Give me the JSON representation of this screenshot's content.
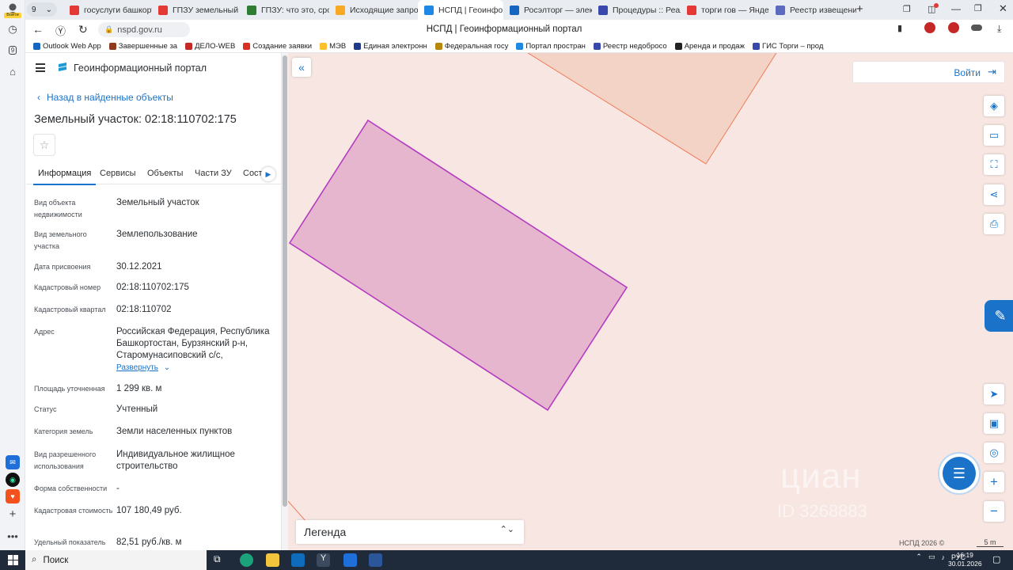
{
  "browser": {
    "tab_count": "9",
    "avatar_label": "Войти",
    "tabs": [
      {
        "label": "госуслуги башкорто",
        "color": "#e53935"
      },
      {
        "label": "ГПЗУ земельный ко",
        "color": "#e53935"
      },
      {
        "label": "ГПЗУ: что это, срок з",
        "color": "#2e7d32"
      },
      {
        "label": "Исходящие запросы",
        "color": "#f9a825"
      },
      {
        "label": "НСПД | Геоинфор",
        "color": "#1e88e5",
        "active": true
      },
      {
        "label": "Росэлторг — электр",
        "color": "#1565c0"
      },
      {
        "label": "Процедуры :: Реали",
        "color": "#3949ab"
      },
      {
        "label": "торги гов — Яндекс",
        "color": "#e53935"
      },
      {
        "label": "Реестр извещений",
        "color": "#5c6bc0"
      }
    ],
    "url": "nspd.gov.ru",
    "page_title": "НСПД | Геоинформационный портал",
    "bookmarks": [
      {
        "label": "Outlook Web App",
        "color": "#1565c0"
      },
      {
        "label": "Завершенные за",
        "color": "#8d3b1d"
      },
      {
        "label": "ДЕЛО-WEB",
        "color": "#c62828"
      },
      {
        "label": "Создание заявки",
        "color": "#d93025"
      },
      {
        "label": "МЭВ",
        "color": "#fbc02d"
      },
      {
        "label": "Единая электронн",
        "color": "#1e3a8a"
      },
      {
        "label": "Федеральная госу",
        "color": "#b8860b"
      },
      {
        "label": "Портал простран",
        "color": "#1e88e5"
      },
      {
        "label": "Реестр недобросо",
        "color": "#3949ab"
      },
      {
        "label": "Аренда и продаж",
        "color": "#222222"
      },
      {
        "label": "ГИС Торги – прод",
        "color": "#3949ab"
      }
    ]
  },
  "panel": {
    "brand": "Геоинформационный портал",
    "back_link": "Назад в найденные объекты",
    "title": "Земельный участок: 02:18:110702:175",
    "tabs": [
      "Информация",
      "Сервисы",
      "Объекты",
      "Части ЗУ",
      "Соста"
    ],
    "fields": [
      {
        "label": "Вид объекта недвижимости",
        "value": "Земельный участок"
      },
      {
        "label": "Вид земельного участка",
        "value": "Землепользование"
      },
      {
        "label": "Дата присвоения",
        "value": "30.12.2021"
      },
      {
        "label": "Кадастровый номер",
        "value": "02:18:110702:175"
      },
      {
        "label": "Кадастровый квартал",
        "value": "02:18:110702"
      },
      {
        "label": "Адрес",
        "value": "Российская Федерация, Республика Башкортостан, Бурзянский р-н, Старомунасиповский с/с,"
      },
      {
        "label": "Площадь уточненная",
        "value": "1 299 кв. м"
      },
      {
        "label": "Статус",
        "value": "Учтенный"
      },
      {
        "label": "Категория земель",
        "value": "Земли населенных пунктов"
      },
      {
        "label": "Вид разрешенного использования",
        "value": "Индивидуальное жилищное строительство"
      },
      {
        "label": "Форма собственности",
        "value": "-"
      },
      {
        "label": "Кадастровая стоимость",
        "value": "107 180,49 руб."
      },
      {
        "label": "Удельный показатель",
        "value": "82,51 руб./кв. м"
      }
    ],
    "expand_label": "Развернуть"
  },
  "map": {
    "login_label": "Войти",
    "legend_label": "Легенда",
    "copyright": "НСПД 2026 ©",
    "scale_label": "5 m",
    "watermark": "циан",
    "watermark_id": "ID 3268883",
    "parcel_fill": "#e6b6cf",
    "parcel_stroke": "#b43cc0",
    "neighbor_fill": "#f2d3c6",
    "neighbor_stroke": "#ef7c5a"
  },
  "taskbar": {
    "search_label": "Поиск",
    "lang": "РУС",
    "time": "16:19",
    "date": "30.01.2026"
  }
}
